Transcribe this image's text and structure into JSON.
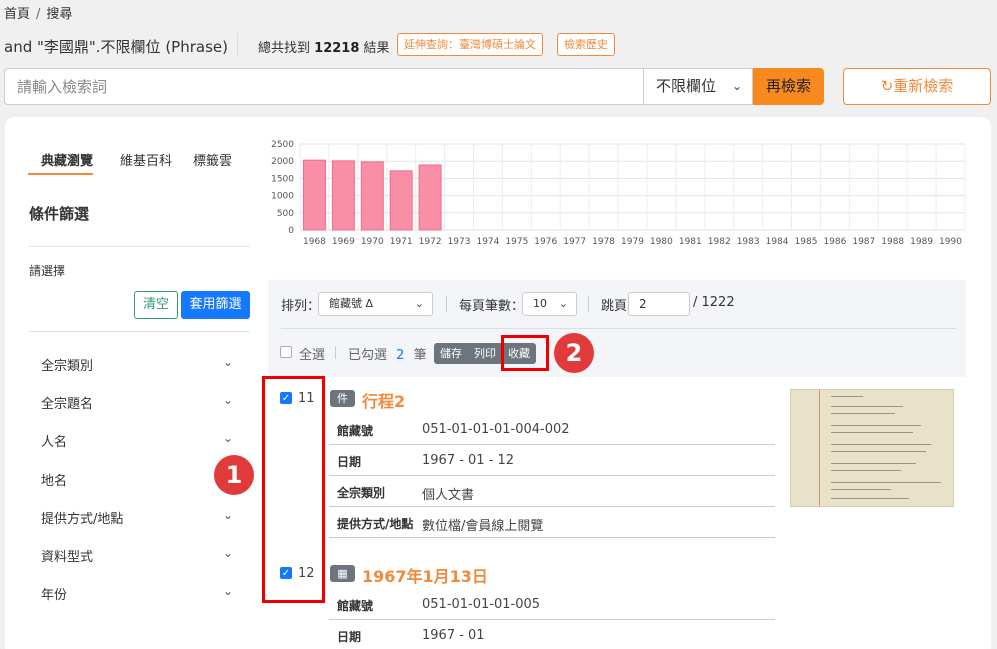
{
  "breadcrumb": {
    "home": "首頁",
    "separator": "/",
    "current": "搜尋"
  },
  "query": {
    "title": "and \"李國鼎\".不限欄位 (Phrase)",
    "total_prefix": "總共找到",
    "total_count": "12218",
    "total_suffix": "結果",
    "extend_btn": "延伸查詢：臺灣博碩士論文",
    "history_btn": "檢索歷史"
  },
  "search": {
    "placeholder": "請輸入檢索詞",
    "field_select": "不限欄位",
    "search_btn": "再檢索",
    "reset_btn": "重新檢索",
    "reset_icon": "refresh-icon"
  },
  "sidebar": {
    "tabs": [
      "典藏瀏覽",
      "維基百科",
      "標籤雲"
    ],
    "filter_title": "條件篩選",
    "prompt": "請選擇",
    "clear_btn": "清空",
    "apply_btn": "套用篩選",
    "facets": [
      "全宗類別",
      "全宗題名",
      "人名",
      "地名",
      "提供方式/地點",
      "資料型式",
      "年份"
    ]
  },
  "chart_data": {
    "type": "bar",
    "categories": [
      "1968",
      "1969",
      "1970",
      "1971",
      "1972",
      "1973",
      "1974",
      "1975",
      "1976",
      "1977",
      "1978",
      "1979",
      "1980",
      "1981",
      "1982",
      "1983",
      "1984",
      "1985",
      "1986",
      "1987",
      "1988",
      "1989",
      "1990"
    ],
    "values": [
      2030,
      2010,
      1980,
      1720,
      1890,
      0,
      0,
      0,
      0,
      0,
      0,
      0,
      0,
      0,
      0,
      0,
      0,
      0,
      0,
      0,
      0,
      0,
      0
    ],
    "yticks": [
      "0",
      "500",
      "1000",
      "1500",
      "2000",
      "2500"
    ],
    "ylim": [
      0,
      2500
    ],
    "bar_color": "#f98fa7",
    "grid": true
  },
  "toolbar": {
    "sort_label": "排列：",
    "sort_value": "館藏號 Δ",
    "per_page_label": "每頁筆數：",
    "per_page_value": "10",
    "jump_label": "跳頁",
    "jump_value": "2",
    "total_pages": "/ 1222",
    "select_all": "全選",
    "selected_prefix": "已勾選",
    "selected_count": "2",
    "selected_suffix": "筆",
    "save_btn": "儲存",
    "print_btn": "列印",
    "collect_btn": "收藏"
  },
  "callouts": [
    "1",
    "2"
  ],
  "results": [
    {
      "num": "11",
      "badge": "件",
      "title": "行程2",
      "fields": [
        {
          "key": "館藏號",
          "value": "051-01-01-01-004-002"
        },
        {
          "key": "日期",
          "value": "1967 - 01 - 12"
        },
        {
          "key": "全宗類別",
          "value": "個人文書"
        },
        {
          "key": "提供方式/地點",
          "value": "數位檔/會員線上閱覽"
        }
      ]
    },
    {
      "num": "12",
      "badge": "▦",
      "title": "1967年1月13日",
      "fields": [
        {
          "key": "館藏號",
          "value": "051-01-01-01-005"
        },
        {
          "key": "日期",
          "value": "1967 - 01"
        }
      ]
    }
  ]
}
